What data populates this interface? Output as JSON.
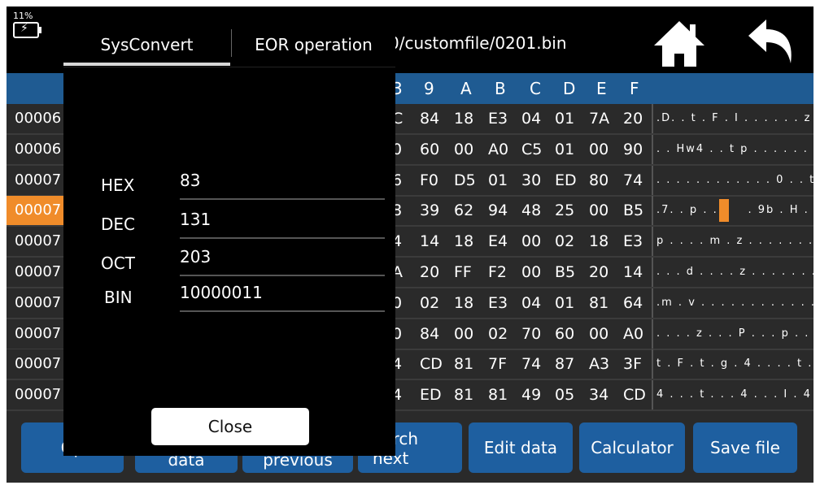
{
  "status": {
    "battery_percent": "11%"
  },
  "header": {
    "file_path": "0/customfile/0201.bin"
  },
  "hex_columns": [
    "9",
    "A",
    "B",
    "C",
    "D",
    "E",
    "F"
  ],
  "hex_col_partial": "3",
  "rows": [
    {
      "addr": "00006",
      "cells": [
        "C",
        "84",
        "18",
        "E3",
        "04",
        "01",
        "7A",
        "20"
      ],
      "ascii": ".D. . t . F . I . . . . . . z ."
    },
    {
      "addr": "00006",
      "cells": [
        "0",
        "60",
        "00",
        "A0",
        "C5",
        "01",
        "00",
        "90"
      ],
      "ascii": ". . Hw4 . . t p . . . . . . ."
    },
    {
      "addr": "00007",
      "cells": [
        "6",
        "F0",
        "D5",
        "01",
        "30",
        "ED",
        "80",
        "74"
      ],
      "ascii": ". . . . . . . . . . . . 0 . . t"
    },
    {
      "addr": "00007",
      "cells": [
        "8",
        "39",
        "62",
        "94",
        "48",
        "25",
        "00",
        "B5"
      ],
      "ascii": ".7. . p . .      . 9b . H . . . ."
    },
    {
      "addr": "00007",
      "cells": [
        "4",
        "14",
        "18",
        "E4",
        "00",
        "02",
        "18",
        "E3"
      ],
      "ascii": "p . . . . m . z . . . . . . . ."
    },
    {
      "addr": "00007",
      "cells": [
        "A",
        "20",
        "FF",
        "F2",
        "00",
        "B5",
        "20",
        "14"
      ],
      "ascii": ". . . d . . . . z . . . . . . ."
    },
    {
      "addr": "00007",
      "cells": [
        "0",
        "02",
        "18",
        "E3",
        "04",
        "01",
        "81",
        "64"
      ],
      "ascii": ".m . v . . . . . . . . . . . . d"
    },
    {
      "addr": "00007",
      "cells": [
        "0",
        "84",
        "00",
        "02",
        "70",
        "60",
        "00",
        "A0"
      ],
      "ascii": ". . . . z . . . P . . . p . . ."
    },
    {
      "addr": "00007",
      "cells": [
        "4",
        "CD",
        "81",
        "7F",
        "74",
        "87",
        "A3",
        "3F"
      ],
      "ascii": "t . F . t . g . 4 . . . . t . . ."
    },
    {
      "addr": "00007",
      "cells": [
        "4",
        "ED",
        "81",
        "81",
        "49",
        "05",
        "34",
        "CD"
      ],
      "ascii": "4 . . . t . . . 4 . . . I . 4 ."
    }
  ],
  "selected_row_index": 3,
  "buttons": {
    "open": "Op",
    "data": "data",
    "previous": "previous",
    "search_next_1": "earch",
    "search_next_2": "next",
    "edit": "Edit data",
    "calculator": "Calculator",
    "save": "Save file"
  },
  "dialog": {
    "tabs": [
      "SysConvert",
      "EOR operation"
    ],
    "active_tab": "SysConvert",
    "fields": [
      {
        "label": "HEX",
        "value": "83"
      },
      {
        "label": "DEC",
        "value": "131"
      },
      {
        "label": "OCT",
        "value": "203"
      },
      {
        "label": "BIN",
        "value": "10000011"
      }
    ],
    "close_label": "Close"
  },
  "colors": {
    "header_blue": "#1f5b92",
    "button_blue": "#1e5fa0",
    "selection_orange": "#f08c2a"
  },
  "icons": [
    "battery-icon",
    "home-icon",
    "back-arrow-icon"
  ]
}
